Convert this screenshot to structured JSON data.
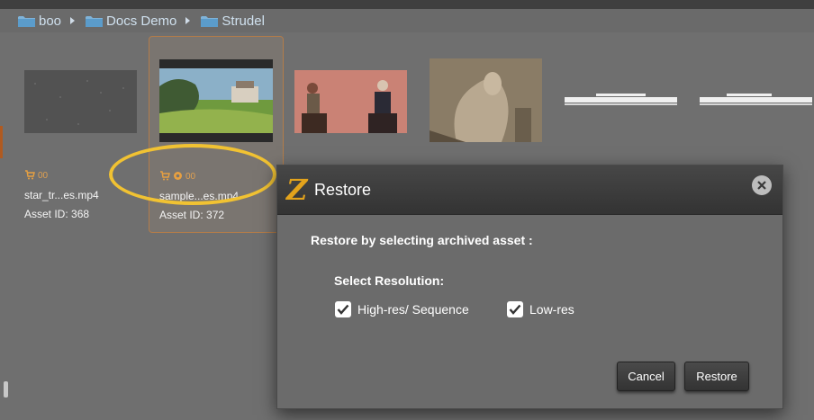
{
  "breadcrumb": {
    "items": [
      {
        "label": "boo"
      },
      {
        "label": "Docs Demo"
      },
      {
        "label": "Strudel"
      }
    ]
  },
  "assets": [
    {
      "name": "star_tr...es.mp4",
      "id_text": "Asset ID: 368",
      "badge": "00"
    },
    {
      "name": "sample...es.mp4",
      "id_text": "Asset ID: 372",
      "badge": "00"
    }
  ],
  "dialog": {
    "title": "Restore",
    "instruction": "Restore by selecting archived asset :",
    "resolution_label": "Select Resolution:",
    "options": [
      {
        "label": "High-res/ Sequence",
        "checked": true
      },
      {
        "label": "Low-res",
        "checked": true
      }
    ],
    "cancel_label": "Cancel",
    "restore_label": "Restore",
    "logo_letter": "Z"
  },
  "colors": {
    "highlight": "#f1c232",
    "accent": "#e3a31c",
    "selected_border": "#b27c4a"
  }
}
